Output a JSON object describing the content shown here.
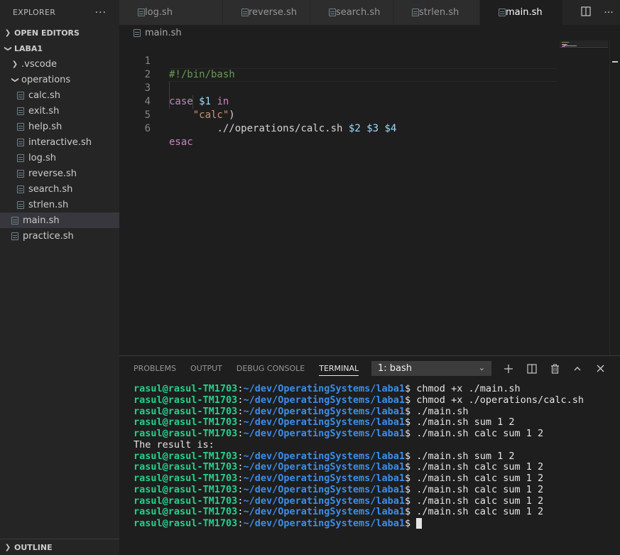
{
  "sidebar": {
    "title": "EXPLORER",
    "more": "···",
    "open_editors": "OPEN EDITORS",
    "workspace": "LABA1",
    "folders": [
      {
        "label": ".vscode"
      },
      {
        "label": "operations"
      }
    ],
    "operation_files": [
      "calc.sh",
      "exit.sh",
      "help.sh",
      "interactive.sh",
      "log.sh",
      "reverse.sh",
      "search.sh",
      "strlen.sh"
    ],
    "root_files": [
      "main.sh",
      "practice.sh"
    ],
    "outline": "OUTLINE"
  },
  "tabs": [
    {
      "label": "log.sh"
    },
    {
      "label": "reverse.sh"
    },
    {
      "label": "search.sh"
    },
    {
      "label": "strlen.sh"
    },
    {
      "label": "main.sh"
    }
  ],
  "breadcrumb": "main.sh",
  "editor": {
    "line_numbers": [
      "1",
      "2",
      "3",
      "4",
      "5",
      "6"
    ],
    "line1": "#!/bin/bash",
    "line3_kw": "case",
    "line3_var": "$1",
    "line3_in": "in",
    "line4_str": "\"calc\"",
    "line4_paren": ")",
    "line5_cmd": ".//operations/calc.sh",
    "line5_a2": "$2",
    "line5_a3": "$3",
    "line5_a4": "$4",
    "line6_kw": "esac"
  },
  "panel": {
    "tabs": [
      "PROBLEMS",
      "OUTPUT",
      "DEBUG CONSOLE",
      "TERMINAL"
    ],
    "terminal_select": "1: bash",
    "terminal": {
      "user": "rasul@rasul-TM1703",
      "sep": ":",
      "path": "~/dev/OperatingSystems/laba1",
      "prompt": "$ ",
      "commands": [
        "chmod +x ./main.sh",
        "chmod +x ./operations/calc.sh",
        "./main.sh",
        "./main.sh sum 1 2",
        "./main.sh calc sum 1 2"
      ],
      "output": "The result is:",
      "commands2": [
        "./main.sh sum 1 2",
        "./main.sh calc sum 1 2",
        "./main.sh calc sum 1 2",
        "./main.sh calc sum 1 2",
        "./main.sh calc sum 1 2",
        "./main.sh calc sum 1 2"
      ]
    }
  },
  "colors": {
    "user": "#23d18b",
    "path": "#3b8eea",
    "keyword": "#c586c0",
    "variable": "#9cdcfe",
    "string": "#ce9178",
    "comment": "#6a9955"
  }
}
